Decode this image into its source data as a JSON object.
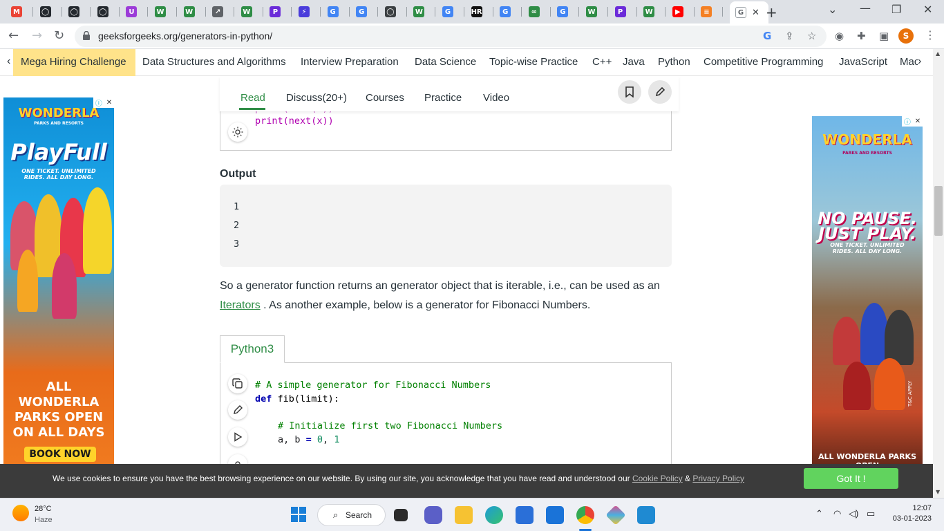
{
  "browser": {
    "tabs": [
      {
        "label": "M",
        "color": "#ea4335"
      },
      {
        "label": "◯",
        "color": "#24292f"
      },
      {
        "label": "◯",
        "color": "#24292f"
      },
      {
        "label": "◯",
        "color": "#24292f"
      },
      {
        "label": "U",
        "color": "#9c3cd8"
      },
      {
        "label": "W",
        "color": "#2f8d46"
      },
      {
        "label": "W",
        "color": "#2f8d46"
      },
      {
        "label": "↗",
        "color": "#5f6368"
      },
      {
        "label": "W",
        "color": "#2f8d46"
      },
      {
        "label": "P",
        "color": "#6b2bd9"
      },
      {
        "label": "⚡",
        "color": "#4a3cdb"
      },
      {
        "label": "G",
        "color": "#4285f4"
      },
      {
        "label": "G",
        "color": "#4285f4"
      },
      {
        "label": "◯",
        "color": "#3c4043"
      },
      {
        "label": "W",
        "color": "#2f8d46"
      },
      {
        "label": "G",
        "color": "#4285f4"
      },
      {
        "label": "HR",
        "color": "#111"
      },
      {
        "label": "G",
        "color": "#4285f4"
      },
      {
        "label": "∞",
        "color": "#2f8d46"
      },
      {
        "label": "G",
        "color": "#4285f4"
      },
      {
        "label": "W",
        "color": "#2f8d46"
      },
      {
        "label": "P",
        "color": "#6b2bd9"
      },
      {
        "label": "W",
        "color": "#2f8d46"
      },
      {
        "label": "▶",
        "color": "#ff0000"
      },
      {
        "label": "≡",
        "color": "#f48024"
      }
    ],
    "active_tab_label": "G",
    "url": "geeksforgeeks.org/generators-in-python/",
    "profile_initial": "S"
  },
  "site_nav": {
    "items": [
      "Mega Hiring Challenge",
      "Data Structures and Algorithms",
      "Interview Preparation",
      "Data Science",
      "Topic-wise Practice",
      "C++",
      "Java",
      "Python",
      "Competitive Programming",
      "JavaScript",
      "Mac"
    ]
  },
  "article_tabs": {
    "items": [
      "Read",
      "Discuss(20+)",
      "Courses",
      "Practice",
      "Video"
    ]
  },
  "code_block_1": {
    "partial_line": "print(next(x))",
    "line": "print(next(x))"
  },
  "output": {
    "heading": "Output",
    "lines": [
      "1",
      "2",
      "3"
    ]
  },
  "paragraph": {
    "before_link": "So a generator function returns an generator object that is iterable, i.e., can be used as an ",
    "link": "Iterators",
    "after_link": " . As another example, below is a generator for Fibonacci Numbers."
  },
  "code_block_2": {
    "tab_label": "Python3",
    "lines": {
      "c1": "# A simple generator for Fibonacci Numbers",
      "def_kw": "def",
      "def_rest": " fib(limit):",
      "c2": "# Initialize first two Fibonacci Numbers",
      "assign_a": "a, b ",
      "assign_eq": "=",
      "assign_0": " 0",
      "assign_comma": ", ",
      "assign_1": "1"
    }
  },
  "ads": {
    "left": {
      "brand": "WONDERLA",
      "brand_sub": "PARKS AND RESORTS",
      "headline": "PlayFull",
      "tagline": "ONE TICKET. UNLIMITED RIDES. ALL DAY LONG.",
      "footer": "ALL WONDERLA PARKS OPEN ON ALL DAYS",
      "cta": "BOOK NOW"
    },
    "right": {
      "brand": "WONDERLA",
      "brand_sub": "PARKS AND RESORTS",
      "headline1": "NO PAUSE.",
      "headline2": "JUST PLAY.",
      "tagline": "ONE TICKET. UNLIMITED RIDES. ALL DAY LONG.",
      "tc": "T&C APPLY",
      "footer": "ALL WONDERLA PARKS OPEN"
    }
  },
  "cookie": {
    "text": "We use cookies to ensure you have the best browsing experience on our website. By using our site, you acknowledge that you have read and understood our ",
    "policy_link": "Cookie Policy",
    "amp": " & ",
    "privacy_link": "Privacy Policy",
    "button": "Got It !"
  },
  "taskbar": {
    "temperature": "28°C",
    "condition": "Haze",
    "search_label": "Search",
    "time": "12:07",
    "date": "03-01-2023"
  }
}
